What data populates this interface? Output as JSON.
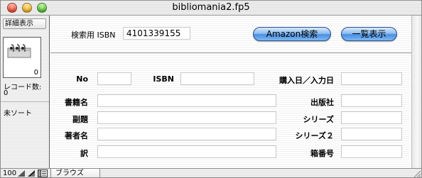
{
  "window": {
    "title": "bibliomania2.fp5"
  },
  "status": {
    "detail_button": "詳細表示",
    "book_count": "0",
    "record_label": "レコード数:",
    "record_value": "0",
    "sort_label": "未ソート"
  },
  "header": {
    "search_label": "検索用 ISBN",
    "search_value": "4101339155",
    "amazon_button": "Amazon検索",
    "list_button": "一覧表示"
  },
  "form": {
    "no_label": "No",
    "no_value": "",
    "isbn_label": "ISBN",
    "isbn_value": "",
    "purchase_label": "購入日／入力日",
    "purchase_value": "",
    "title_label": "書籍名",
    "title_value": "",
    "publisher_label": "出版社",
    "publisher_value": "",
    "subtitle_label": "副題",
    "subtitle_value": "",
    "series_label": "シリーズ",
    "series_value": "",
    "author_label": "著者名",
    "author_value": "",
    "series2_label": "シリーズ２",
    "series2_value": "",
    "translator_label": "訳",
    "translator_value": "",
    "box_label": "箱番号",
    "box_value": ""
  },
  "bottom": {
    "zoom": "100",
    "mode": "ブラウズ"
  },
  "colors": {
    "aqua_button": "#6aa7ec",
    "close": "#e94b35",
    "minimize": "#f5b52a",
    "maximize": "#5cc63a"
  }
}
